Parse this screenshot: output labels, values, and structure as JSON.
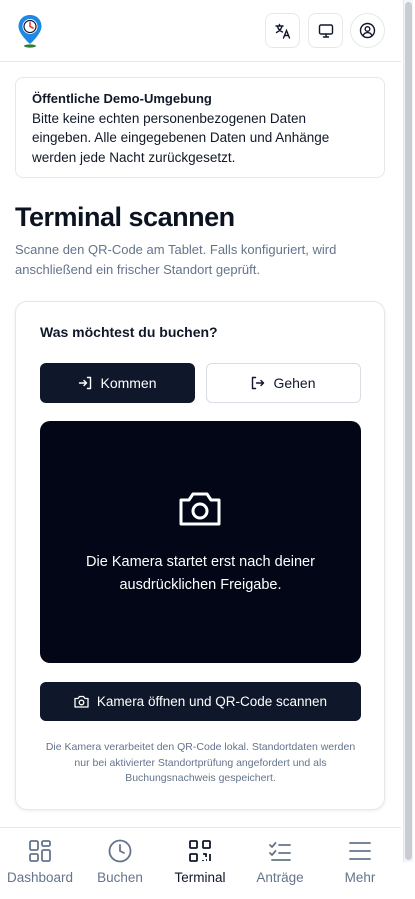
{
  "notice": {
    "title": "Öffentliche Demo-Umgebung",
    "body": "Bitte keine echten personenbezogenen Daten eingeben. Alle eingegebenen Daten und Anhänge werden jede Nacht zurückgesetzt."
  },
  "page": {
    "title": "Terminal scannen",
    "subtitle": "Scanne den QR-Code am Tablet. Falls konfiguriert, wird anschließend ein frischer Standort geprüft."
  },
  "booking": {
    "question": "Was möchtest du buchen?",
    "options": [
      {
        "label": "Kommen",
        "icon": "login-icon",
        "selected": true
      },
      {
        "label": "Gehen",
        "icon": "logout-icon",
        "selected": false
      }
    ]
  },
  "camera": {
    "message_line1": "Die Kamera startet erst nach deiner",
    "message_line2": "ausdrücklichen Freigabe.",
    "scan_button": "Kamera öffnen und QR-Code scannen",
    "footnote": "Die Kamera verarbeitet den QR-Code lokal. Standortdaten werden nur bei aktivierter Standortprüfung angefordert und als Buchungsnachweis gespeichert."
  },
  "nav": {
    "items": [
      {
        "label": "Dashboard",
        "icon": "dashboard-icon",
        "active": false
      },
      {
        "label": "Buchen",
        "icon": "clock-icon",
        "active": false
      },
      {
        "label": "Terminal",
        "icon": "qr-code-icon",
        "active": true
      },
      {
        "label": "Anträge",
        "icon": "checklist-icon",
        "active": false
      },
      {
        "label": "Mehr",
        "icon": "menu-icon",
        "active": false
      }
    ]
  },
  "colors": {
    "primary": "#0f172a",
    "camera_bg": "#020617",
    "muted_text": "#64748b",
    "border": "#e5e7eb",
    "logo_blue": "#1e88e5"
  }
}
